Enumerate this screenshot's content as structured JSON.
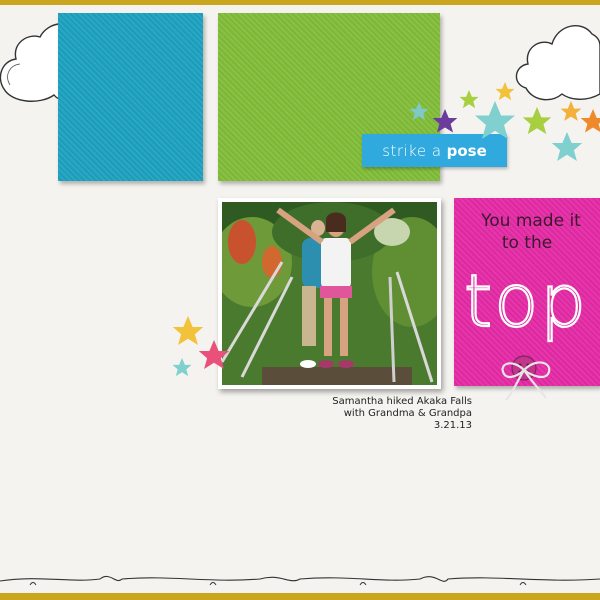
{
  "label": {
    "strike": "strike a",
    "pose": "pose"
  },
  "pink_card": {
    "line1": "You made it",
    "line2": "to the",
    "big_word": "top"
  },
  "caption": {
    "line1": "Samantha hiked Akaka Falls",
    "line2": "with Grandma & Grandpa",
    "line3": "3.21.13"
  },
  "colors": {
    "teal_paper": "#1ea2c2",
    "green_paper": "#83be3a",
    "pink_paper": "#e52ba6",
    "label_blue": "#2fa9de",
    "frame_gold": "#c9a61e"
  },
  "icons": {
    "clouds": "cloud-icon",
    "stars": "star-icon",
    "button": "button-icon",
    "twine": "bow-icon"
  }
}
